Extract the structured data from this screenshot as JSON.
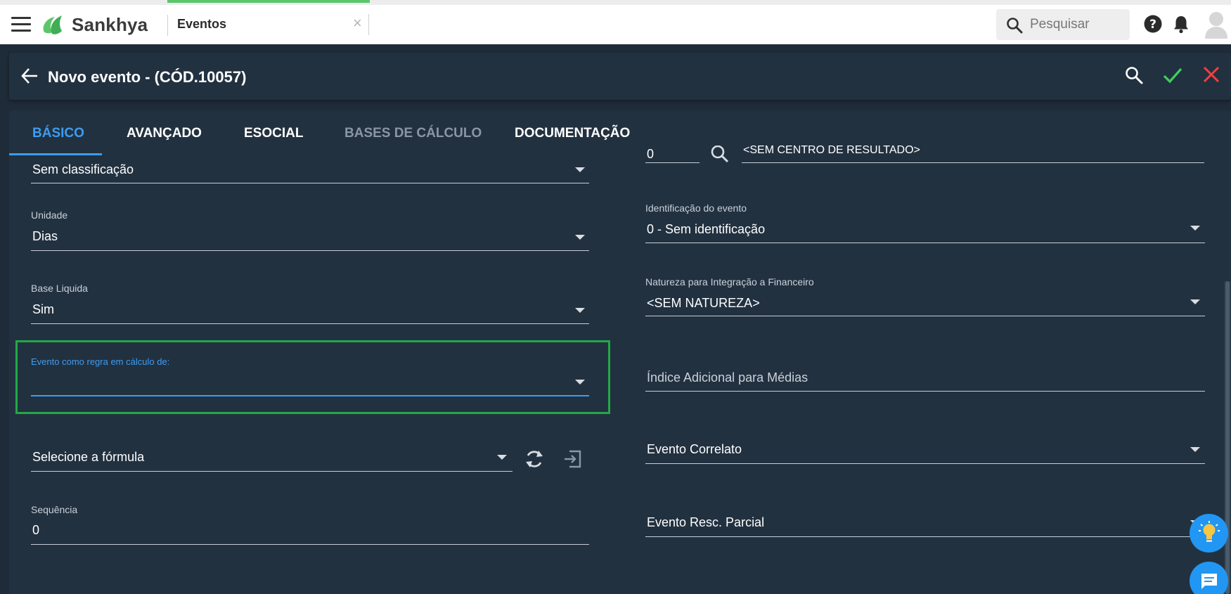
{
  "app": {
    "brand": "Sankhya",
    "tab_label": "Eventos",
    "search_placeholder": "Pesquisar"
  },
  "header": {
    "title": "Novo evento - (CÓD.10057)"
  },
  "tabs": [
    {
      "label": "BÁSICO",
      "state": "active"
    },
    {
      "label": "AVANÇADO",
      "state": "normal"
    },
    {
      "label": "ESOCIAL",
      "state": "normal"
    },
    {
      "label": "BASES DE CÁLCULO",
      "state": "disabled"
    },
    {
      "label": "DOCUMENTAÇÃO",
      "state": "normal"
    }
  ],
  "left_fields": {
    "classificacao": {
      "value": "Sem classificação"
    },
    "unidade": {
      "label": "Unidade",
      "value": "Dias"
    },
    "base_liquida": {
      "label": "Base Liquida",
      "value": "Sim"
    },
    "evento_regra": {
      "label": "Evento como regra em cálculo de:",
      "value": ""
    },
    "formula": {
      "value": "Selecione a fórmula"
    },
    "sequencia": {
      "label": "Sequência",
      "value": "0"
    }
  },
  "right_fields": {
    "centro_resultado": {
      "code": "0",
      "value": "<SEM CENTRO DE RESULTADO>"
    },
    "identificacao": {
      "label": "Identificação do evento",
      "value": "0 - Sem identificação"
    },
    "natureza": {
      "label": "Natureza para Integração a Financeiro",
      "value": "<SEM NATUREZA>"
    },
    "indice": {
      "value": "Índice Adicional para Médias"
    },
    "correlato": {
      "value": "Evento Correlato"
    },
    "resc_parcial": {
      "value": "Evento Resc. Parcial"
    }
  },
  "colors": {
    "accent": "#3d9cf0",
    "confirm": "#3ecf5a",
    "cancel": "#f04040",
    "highlight": "#22a845",
    "brand_green": "#5cc66b"
  }
}
